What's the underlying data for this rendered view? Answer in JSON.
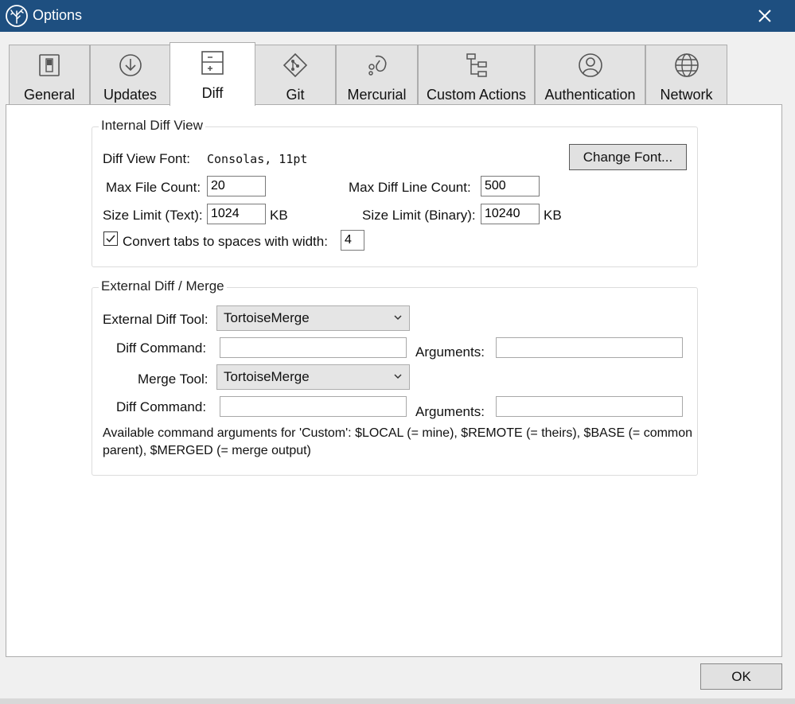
{
  "window": {
    "title": "Options",
    "close_glyph": "✕",
    "app_icon": "tree-icon"
  },
  "tabs": [
    {
      "label": "General",
      "icon": "toggle-switch-icon",
      "active": false
    },
    {
      "label": "Updates",
      "icon": "download-circle-icon",
      "active": false
    },
    {
      "label": "Diff",
      "icon": "diff-document-icon",
      "active": true
    },
    {
      "label": "Git",
      "icon": "git-icon",
      "active": false
    },
    {
      "label": "Mercurial",
      "icon": "mercurial-icon",
      "active": false
    },
    {
      "label": "Custom Actions",
      "icon": "flowchart-icon",
      "active": false
    },
    {
      "label": "Authentication",
      "icon": "user-circle-icon",
      "active": false
    },
    {
      "label": "Network",
      "icon": "globe-icon",
      "active": false
    }
  ],
  "internal": {
    "title": "Internal Diff View",
    "font_label": "Diff View Font:",
    "font_value": "Consolas, 11pt",
    "change_font": "Change Font...",
    "max_file_label": "Max File Count:",
    "max_file_value": "20",
    "max_line_label": "Max Diff Line Count:",
    "max_line_value": "500",
    "size_text_label": "Size Limit (Text):",
    "size_text_value": "1024",
    "size_text_unit": "KB",
    "size_bin_label": "Size Limit (Binary):",
    "size_bin_value": "10240",
    "size_bin_unit": "KB",
    "tabs_label": "Convert tabs to spaces with width:",
    "tabs_checked": true,
    "tabs_value": "4"
  },
  "external": {
    "title": "External Diff / Merge",
    "diff_tool_label": "External Diff Tool:",
    "diff_tool_value": "TortoiseMerge",
    "diff_cmd_label": "Diff Command:",
    "diff_cmd_value": "",
    "diff_args_label": "Arguments:",
    "diff_args_value": "",
    "merge_tool_label": "Merge Tool:",
    "merge_tool_value": "TortoiseMerge",
    "merge_cmd_label": "Diff Command:",
    "merge_cmd_value": "",
    "merge_args_label": "Arguments:",
    "merge_args_value": "",
    "note_line1": "Available command arguments for 'Custom': $LOCAL (= mine), $REMOTE (= theirs), $BASE (= common",
    "note_line2": "parent), $MERGED (= merge output)"
  },
  "footer": {
    "ok": "OK"
  }
}
